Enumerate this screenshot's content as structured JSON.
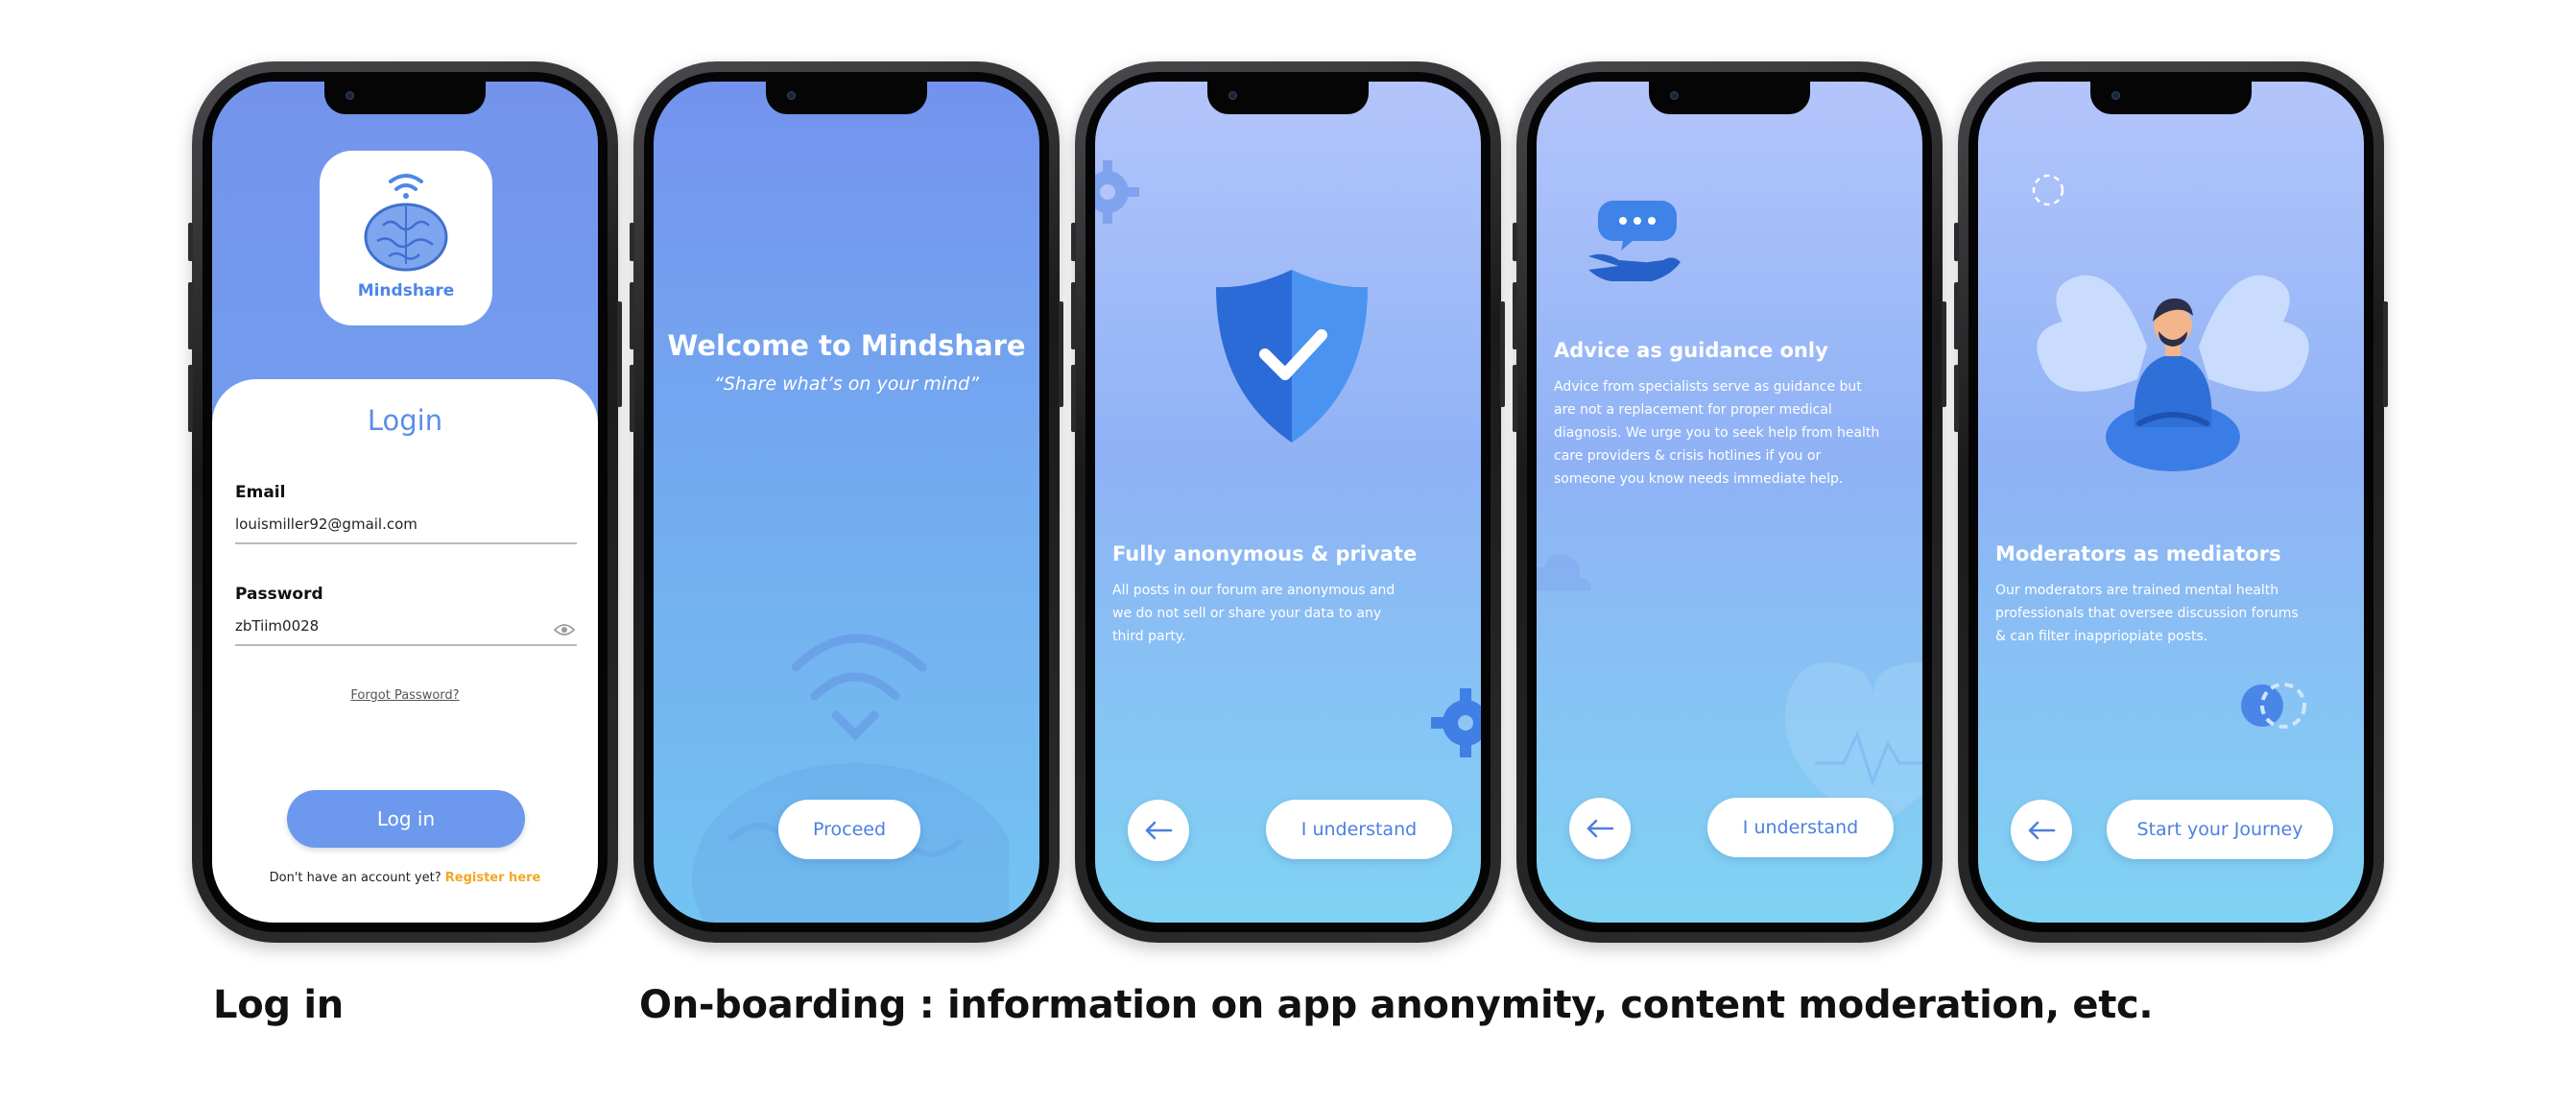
{
  "login": {
    "brand": "Mindshare",
    "title": "Login",
    "email_label": "Email",
    "email_value": "louismiller92@gmail.com",
    "password_label": "Password",
    "password_value": "zbTiim0028",
    "forgot_link": "Forgot Password?",
    "login_button": "Log in",
    "register_prompt": "Don't have an account yet?",
    "register_link": "Register here"
  },
  "welcome": {
    "title": "Welcome to Mindshare",
    "tagline": "“Share what’s on your mind”",
    "proceed_button": "Proceed"
  },
  "anonymity": {
    "title": "Fully anonymous & private",
    "body": "All posts in our forum are anonymous and we do not sell or share your data to any third party.",
    "confirm_button": "I understand"
  },
  "advice": {
    "title": "Advice as guidance only",
    "body": "Advice from specialists serve as guidance but are not a replacement for proper medical diagnosis. We urge you to seek help from health care providers & crisis hotlines if you or someone you know needs immediate help.",
    "confirm_button": "I understand"
  },
  "moderators": {
    "title": "Moderators as mediators",
    "body": "Our moderators are trained mental health professionals that oversee discussion forums & can filter inappriopiate posts.",
    "start_button": "Start your Journey"
  },
  "captions": {
    "login": "Log in",
    "onboarding": "On-boarding : information on app anonymity, content moderation, etc."
  },
  "icons": {
    "back": "arrow-left-icon",
    "password_toggle": "eye-icon",
    "logo": "brain-wifi-icon",
    "shield": "shield-check-icon",
    "advice": "chat-hand-icon",
    "moderator": "meditating-person-icon"
  },
  "colors": {
    "accent": "#5b8ee9",
    "button_blue": "#6c99ee",
    "register_link": "#f5a623",
    "button_text": "#4d80e0"
  }
}
